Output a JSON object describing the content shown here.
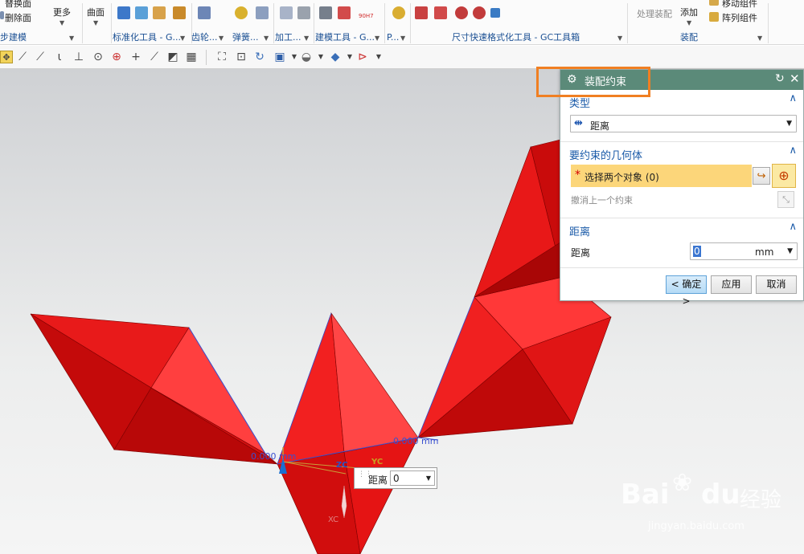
{
  "ribbon": {
    "top_left": [
      "替换面",
      "删除面"
    ],
    "more_label": "更多",
    "surface_label": "曲面",
    "handle_label": "处理装配",
    "add_label": "添加",
    "move_label": "移动组件",
    "array_label": "阵列组件",
    "groups": [
      "步建模",
      "标准化工具 - G...",
      "齿轮...",
      "弹簧...",
      "加工...",
      "建模工具 - G...",
      "P...",
      "尺寸快速格式化工具 - GC工具箱",
      "装配"
    ],
    "h7_label": "90H7"
  },
  "dialog": {
    "title": "装配约束",
    "type_section": "类型",
    "type_value": "距离",
    "geom_section": "要约束的几何体",
    "select_label": "选择两个对象 (0)",
    "undo_label": "撤消上一个约束",
    "dist_section": "距离",
    "dist_label": "距离",
    "dist_value": "0",
    "dist_unit": "mm",
    "ok_label": "< 确定 >",
    "apply_label": "应用",
    "cancel_label": "取消",
    "required_mark": "*"
  },
  "viewport": {
    "dim_left": "0.000 mm",
    "dim_right": "0.000 mm",
    "axis_yc": "YC",
    "axis_zc": "ZC",
    "axis_xc": "XC",
    "dist_box_label": "距离",
    "dist_box_value": "0"
  },
  "watermark": {
    "brand": "Bai",
    "brand2": "du",
    "cn": "经验",
    "url": "jingyan.baidu.com"
  },
  "colors": {
    "accent": "#5b8a79",
    "highlight": "#f07f22",
    "select_bg": "#fcd67a",
    "part_red": "#e01010"
  }
}
